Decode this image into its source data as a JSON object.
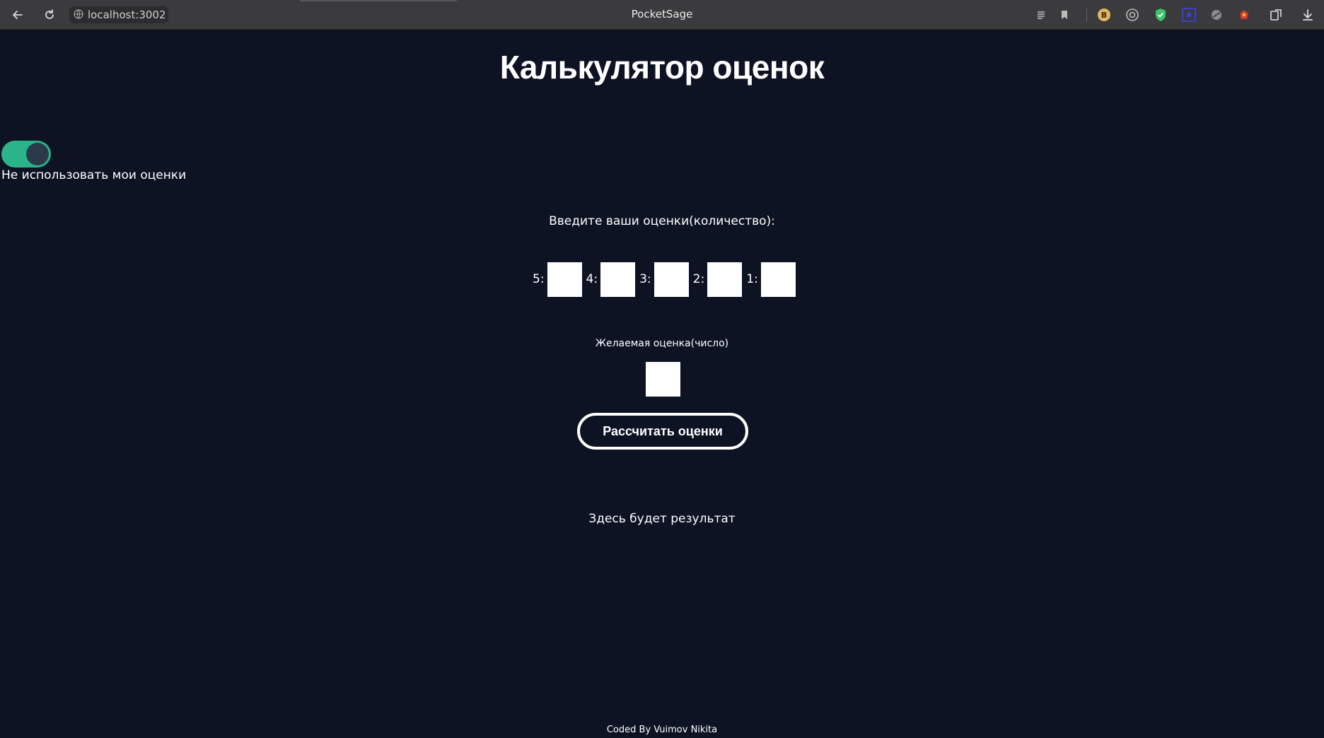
{
  "browser": {
    "url": "localhost:3002",
    "title": "PocketSage",
    "extension_icons": [
      "reader-icon",
      "bookmark-icon",
      "b-extension-icon",
      "at-extension-icon",
      "shield-extension-icon",
      "square-extension-icon",
      "leaf-extension-icon",
      "fox-extension-icon",
      "extensions-icon",
      "download-icon"
    ]
  },
  "page": {
    "title": "Калькулятор оценок",
    "toggle_label": "Не использовать мои оценки",
    "toggle_on": true,
    "prompt": "Введите ваши оценки(количество):",
    "grades": [
      {
        "label": "5:",
        "value": ""
      },
      {
        "label": "4:",
        "value": ""
      },
      {
        "label": "3:",
        "value": ""
      },
      {
        "label": "2:",
        "value": ""
      },
      {
        "label": "1:",
        "value": ""
      }
    ],
    "desired_label": "Желаемая оценка(число)",
    "desired_value": "",
    "calc_button": "Рассчитать оценки",
    "result": "Здесь будет результат",
    "footer": "Coded By Vuimov Nikita"
  },
  "colors": {
    "background": "#0e1324",
    "toggle_track": "#2bb389",
    "toggle_knob": "#2a3a4a"
  }
}
